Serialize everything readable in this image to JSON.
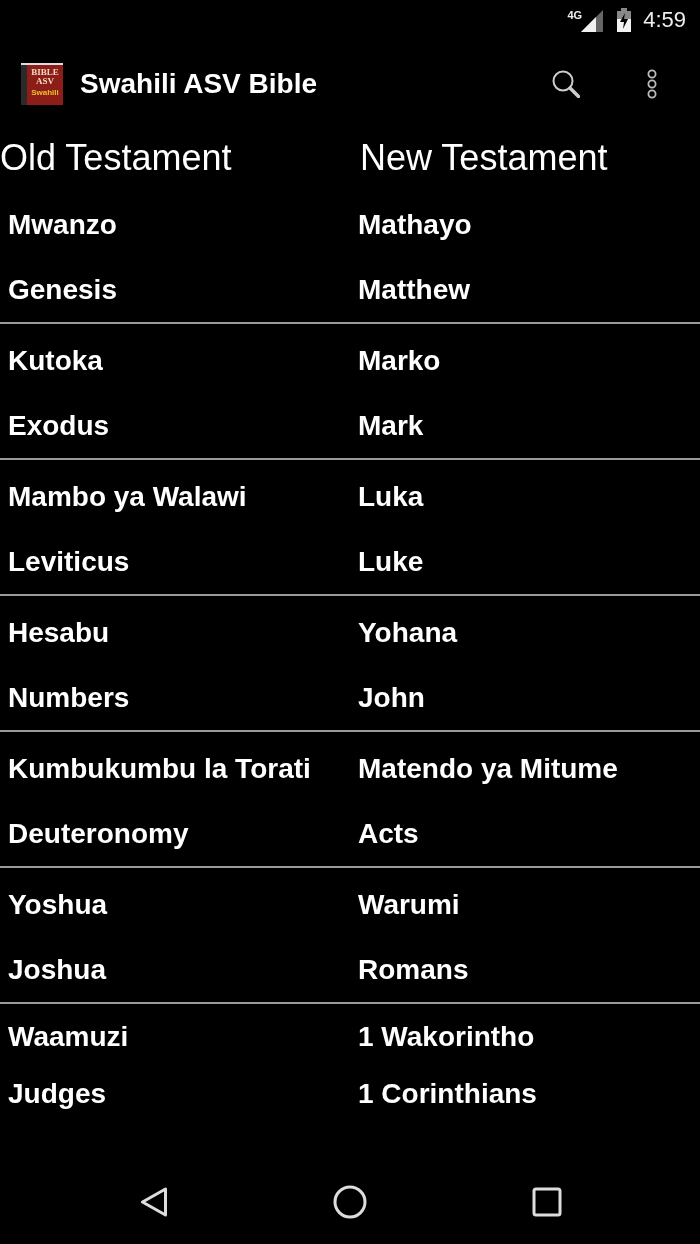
{
  "status_bar": {
    "network": "4G",
    "time": "4:59"
  },
  "app_bar": {
    "logo_lines": [
      "BIBLE",
      "ASV"
    ],
    "logo_label": "Swahili",
    "title": "Swahili ASV Bible"
  },
  "columns": [
    {
      "heading": "Old Testament"
    },
    {
      "heading": "New Testament"
    }
  ],
  "groups": [
    {
      "books": [
        {
          "swahili": "Mwanzo",
          "english": "Genesis"
        },
        {
          "swahili": "Mathayo",
          "english": "Matthew"
        }
      ]
    },
    {
      "books": [
        {
          "swahili": "Kutoka",
          "english": "Exodus"
        },
        {
          "swahili": "Marko",
          "english": "Mark"
        }
      ]
    },
    {
      "books": [
        {
          "swahili": "Mambo ya Walawi",
          "english": "Leviticus"
        },
        {
          "swahili": "Luka",
          "english": "Luke"
        }
      ]
    },
    {
      "books": [
        {
          "swahili": "Hesabu",
          "english": "Numbers"
        },
        {
          "swahili": "Yohana",
          "english": "John"
        }
      ]
    },
    {
      "books": [
        {
          "swahili": "Kumbukumbu la Torati",
          "english": "Deuteronomy"
        },
        {
          "swahili": "Matendo ya Mitume",
          "english": "Acts"
        }
      ]
    },
    {
      "books": [
        {
          "swahili": "Yoshua",
          "english": "Joshua"
        },
        {
          "swahili": "Warumi",
          "english": "Romans"
        }
      ]
    },
    {
      "books": [
        {
          "swahili": "Waamuzi",
          "english": "Judges"
        },
        {
          "swahili": "1 Wakorintho",
          "english": "1 Corinthians"
        }
      ]
    }
  ]
}
